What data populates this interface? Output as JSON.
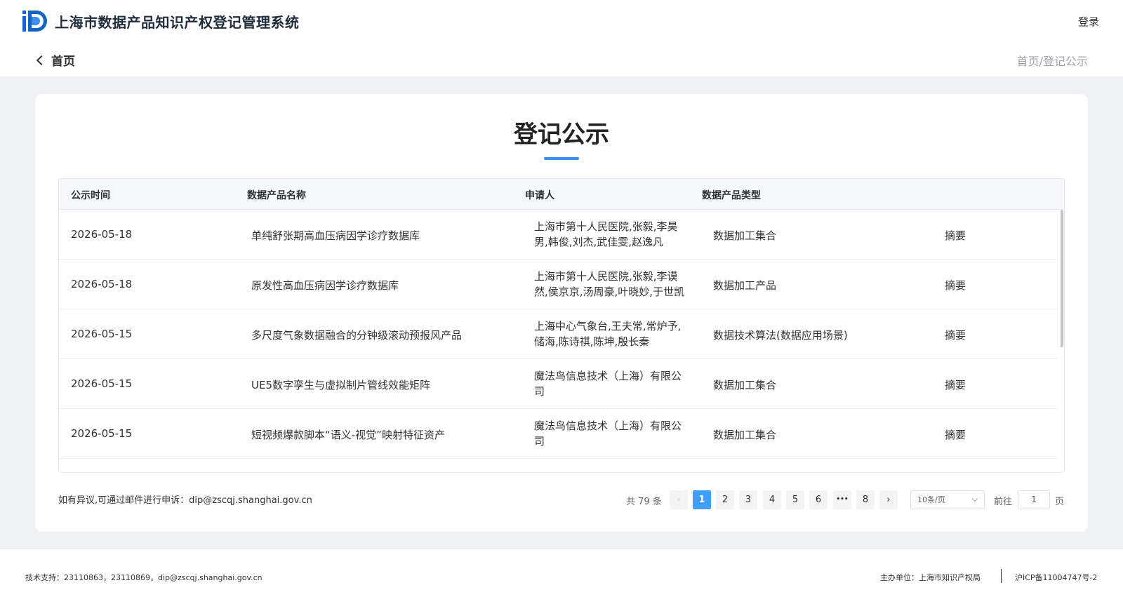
{
  "header": {
    "site_title": "上海市数据产品知识产权登记管理系统",
    "login_label": "登录",
    "logo_icon": "ip-logo-icon",
    "brand_color": "#1565c0"
  },
  "nav": {
    "back_label": "首页",
    "breadcrumb": "首页/登记公示"
  },
  "main": {
    "title": "登记公示",
    "accent_color": "#3d8ef0",
    "columns": [
      "公示时间",
      "数据产品名称",
      "申请人",
      "数据产品类型"
    ],
    "rows": [
      {
        "date": "2026-05-18",
        "name": "单纯舒张期高血压病因学诊疗数据库",
        "applicant": "上海市第十人民医院,张毅,李昊男,韩俊,刘杰,武佳雯,赵逸凡",
        "type": "数据加工集合",
        "action": "摘要"
      },
      {
        "date": "2026-05-18",
        "name": "原发性高血压病因学诊疗数据库",
        "applicant": "上海市第十人民医院,张毅,李谟然,侯京京,汤周豪,叶晓妙,于世凯",
        "type": "数据加工产品",
        "action": "摘要"
      },
      {
        "date": "2026-05-15",
        "name": "多尺度气象数据融合的分钟级滚动预报风产品",
        "applicant": "上海中心气象台,王夫常,常炉予,储海,陈诗祺,陈坤,殷长秦",
        "type": "数据技术算法(数据应用场景)",
        "action": "摘要"
      },
      {
        "date": "2026-05-15",
        "name": "UE5数字孪生与虚拟制片管线效能矩阵",
        "applicant": "魔法鸟信息技术（上海）有限公司",
        "type": "数据加工集合",
        "action": "摘要"
      },
      {
        "date": "2026-05-15",
        "name": "短视频爆款脚本“语义-视觉”映射特征资产",
        "applicant": "魔法鸟信息技术（上海）有限公司",
        "type": "数据加工集合",
        "action": "摘要"
      }
    ],
    "footnote": "如有异议,可通过邮件进行申诉：dip@zscqj.shanghai.gov.cn"
  },
  "pagination": {
    "total": "共 79 条",
    "pages": [
      "1",
      "2",
      "3",
      "4",
      "5",
      "6",
      "•••",
      "8"
    ],
    "current": "1",
    "page_size": "10条/页",
    "goto_label": "前往",
    "goto_value": "1",
    "page_suffix": "页",
    "prev_glyph": "‹",
    "next_glyph": "›"
  },
  "footer": {
    "support": "技术支持：23110863，23110869，dip@zscqj.shanghai.gov.cn",
    "sponsor": "主办单位：上海市知识产权局",
    "icp": "沪ICP备11004747号-2"
  }
}
